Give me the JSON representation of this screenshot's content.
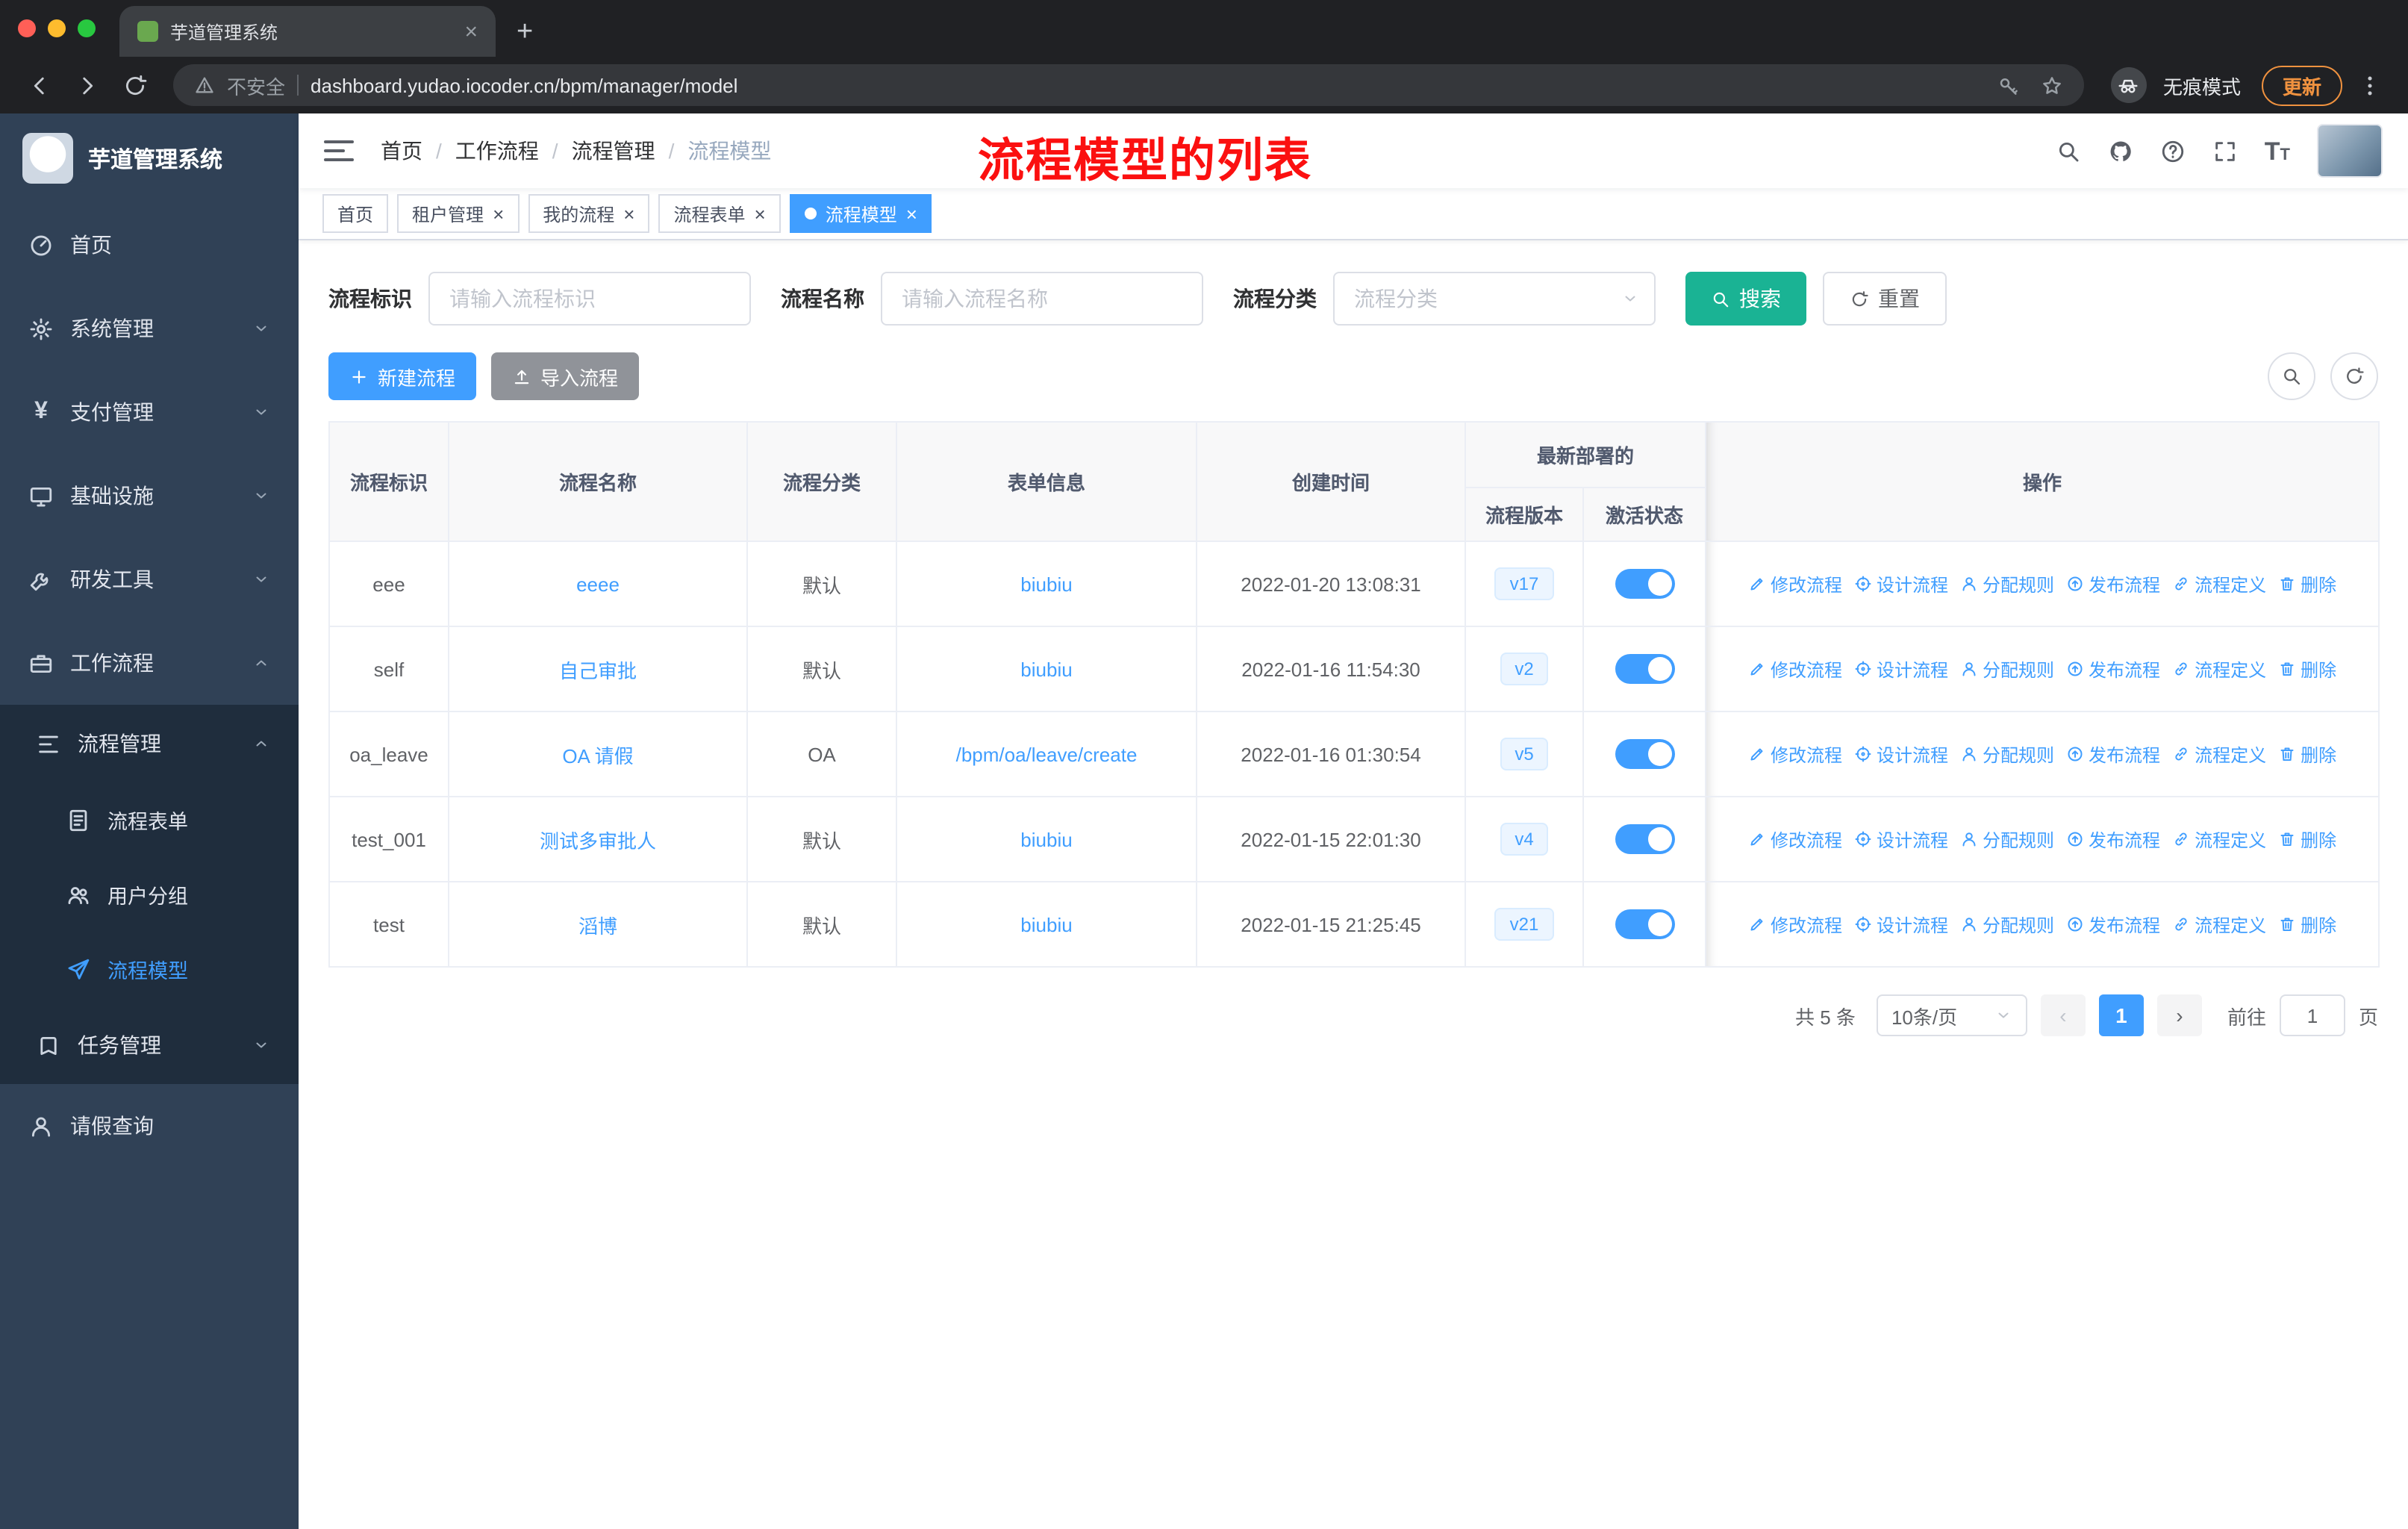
{
  "colors": {
    "accent": "#409eff",
    "search_button": "#1ab394",
    "sidebar_bg": "#304156",
    "sidebar_sub_bg": "#1f2d3d",
    "annotation_red": "#fb1010",
    "tag_bg": "#ecf5ff"
  },
  "browser": {
    "tab_title": "芋道管理系统",
    "url_warning": "不安全",
    "url": "dashboard.yudao.iocoder.cn/bpm/manager/model",
    "incognito_label": "无痕模式",
    "update_label": "更新"
  },
  "sidebar": {
    "title": "芋道管理系统",
    "items": [
      {
        "label": "首页"
      },
      {
        "label": "系统管理"
      },
      {
        "label": "支付管理"
      },
      {
        "label": "基础设施"
      },
      {
        "label": "研发工具"
      },
      {
        "label": "工作流程"
      }
    ],
    "process_mgmt": {
      "label": "流程管理",
      "children": [
        {
          "label": "流程表单"
        },
        {
          "label": "用户分组"
        },
        {
          "label": "流程模型"
        }
      ]
    },
    "task_mgmt": {
      "label": "任务管理"
    },
    "leave_query": {
      "label": "请假查询"
    }
  },
  "navbar": {
    "breadcrumb": [
      "首页",
      "工作流程",
      "流程管理",
      "流程模型"
    ],
    "annotation": "流程模型的列表"
  },
  "tags": [
    {
      "label": "首页"
    },
    {
      "label": "租户管理"
    },
    {
      "label": "我的流程"
    },
    {
      "label": "流程表单"
    },
    {
      "label": "流程模型"
    }
  ],
  "filters": {
    "key_label": "流程标识",
    "key_placeholder": "请输入流程标识",
    "name_label": "流程名称",
    "name_placeholder": "请输入流程名称",
    "category_label": "流程分类",
    "category_placeholder": "流程分类",
    "search_label": "搜索",
    "reset_label": "重置"
  },
  "actions_bar": {
    "create_label": "新建流程",
    "import_label": "导入流程"
  },
  "table": {
    "headers": {
      "key": "流程标识",
      "name": "流程名称",
      "category": "流程分类",
      "form": "表单信息",
      "created": "创建时间",
      "deploy_group": "最新部署的",
      "version": "流程版本",
      "status": "激活状态",
      "ops": "操作"
    },
    "action_labels": [
      "修改流程",
      "设计流程",
      "分配规则",
      "发布流程",
      "流程定义",
      "删除"
    ],
    "rows": [
      {
        "key": "eee",
        "name": "eeee",
        "category": "默认",
        "form": "biubiu",
        "created": "2022-01-20 13:08:31",
        "version": "v17",
        "active": true
      },
      {
        "key": "self",
        "name": "自己审批",
        "category": "默认",
        "form": "biubiu",
        "created": "2022-01-16 11:54:30",
        "version": "v2",
        "active": true
      },
      {
        "key": "oa_leave",
        "name": "OA 请假",
        "category": "OA",
        "form": "/bpm/oa/leave/create",
        "created": "2022-01-16 01:30:54",
        "version": "v5",
        "active": true
      },
      {
        "key": "test_001",
        "name": "测试多审批人",
        "category": "默认",
        "form": "biubiu",
        "created": "2022-01-15 22:01:30",
        "version": "v4",
        "active": true
      },
      {
        "key": "test",
        "name": "滔博",
        "category": "默认",
        "form": "biubiu",
        "created": "2022-01-15 21:25:45",
        "version": "v21",
        "active": true
      }
    ]
  },
  "pagination": {
    "total": "共 5 条",
    "page_size": "10条/页",
    "prev": "‹",
    "current": "1",
    "next": "›",
    "goto_label": "前往",
    "goto_value": "1",
    "page_suffix": "页"
  },
  "icons": {
    "not_secure": "warning-triangle",
    "key": "password-key",
    "star": "bookmark-star",
    "incognito": "glasses",
    "menu": "vertical-dots",
    "search": "magnifier",
    "github": "octocat",
    "help": "question-circle",
    "fullscreen": "expand-corners",
    "font_size": "letter-T",
    "home": "gauge",
    "system": "gear",
    "pay": "yen",
    "infra": "monitor",
    "devtool": "wrench",
    "workflow": "briefcase",
    "process_mgmt": "indent-list",
    "form": "document",
    "group": "people",
    "model": "paper-plane",
    "task": "bookmark",
    "leave": "person",
    "edit": "pencil",
    "design": "crosshair",
    "assign": "person",
    "publish": "arrow-up-circle",
    "definition": "link",
    "delete": "trash",
    "create": "plus",
    "import": "upload",
    "refresh": "circular-arrow"
  }
}
